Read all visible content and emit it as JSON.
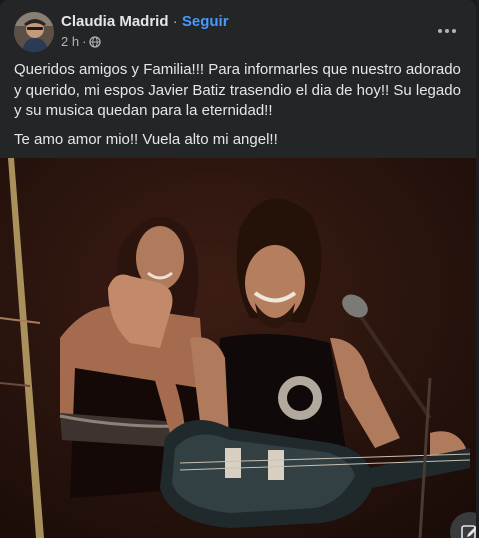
{
  "post": {
    "author": "Claudia Madrid",
    "separator": "·",
    "follow_label": "Seguir",
    "time": "2 h",
    "meta_separator": "·",
    "audience_icon": "globe-icon",
    "more_icon": "more-horizontal-icon",
    "paragraphs": [
      "Queridos amigos y Familia!!! Para informarles que nuestro adorado y querido, mi espos Javier Batiz trasendio el dia de hoy!! Su legado y su musica quedan para la eternidad!!",
      "Te amo amor mio!! Vuela alto mi angel!!"
    ]
  },
  "compose_icon": "edit-message-icon",
  "colors": {
    "background": "#242526",
    "text": "#e4e6eb",
    "secondary_text": "#b0b3b8",
    "link": "#4599ff"
  }
}
